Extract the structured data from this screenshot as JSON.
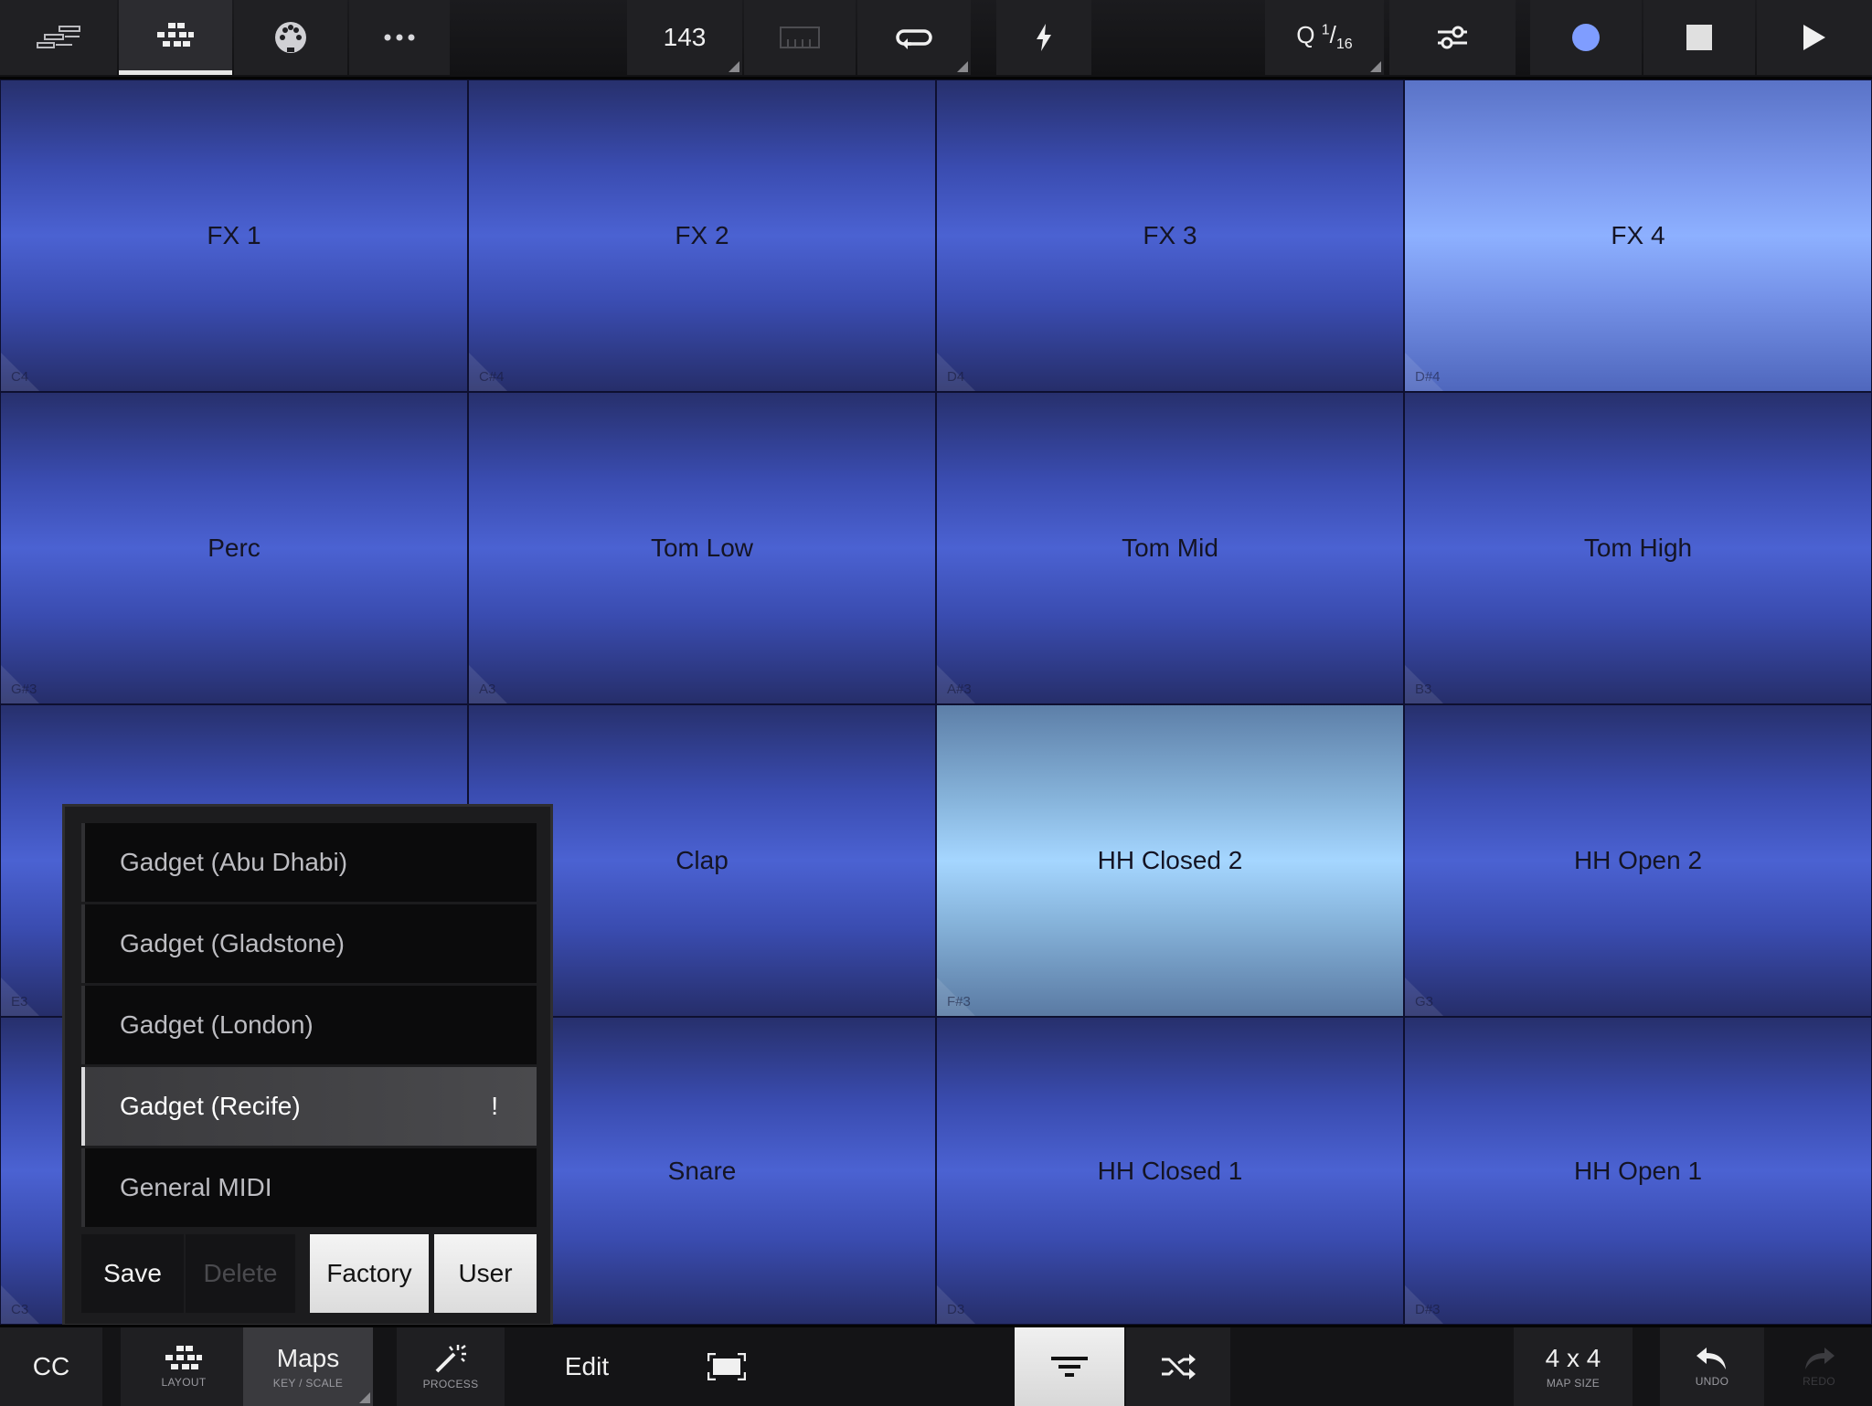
{
  "topbar": {
    "tabs": [
      "sequencer-icon",
      "pads-icon",
      "midi-port-icon",
      "more-icon"
    ],
    "tempo": "143",
    "quantize": {
      "prefix": "Q",
      "numerator": "1",
      "denominator": "16"
    },
    "icons": [
      "metronome-icon",
      "loop-icon",
      "bolt-icon",
      "mixer-icon",
      "record-icon",
      "stop-icon",
      "play-icon"
    ]
  },
  "pads": [
    {
      "name": "FX 1",
      "note": "C4"
    },
    {
      "name": "FX 2",
      "note": "C#4"
    },
    {
      "name": "FX 3",
      "note": "D4"
    },
    {
      "name": "FX 4",
      "note": "D#4"
    },
    {
      "name": "Perc",
      "note": "G#3"
    },
    {
      "name": "Tom Low",
      "note": "A3"
    },
    {
      "name": "Tom Mid",
      "note": "A#3"
    },
    {
      "name": "Tom High",
      "note": "B3"
    },
    {
      "name": "",
      "note": "E3"
    },
    {
      "name": "Clap",
      "note": ""
    },
    {
      "name": "HH Closed 2",
      "note": "F#3"
    },
    {
      "name": "HH Open 2",
      "note": "G3"
    },
    {
      "name": "",
      "note": "C3"
    },
    {
      "name": "Snare",
      "note": ""
    },
    {
      "name": "HH Closed 1",
      "note": "D3"
    },
    {
      "name": "HH Open 1",
      "note": "D#3"
    }
  ],
  "maps_popup": {
    "items": [
      {
        "label": "Gadget (Abu Dhabi)"
      },
      {
        "label": "Gadget (Gladstone)"
      },
      {
        "label": "Gadget (London)"
      },
      {
        "label": "Gadget (Recife)",
        "badge": "!"
      },
      {
        "label": "General MIDI"
      }
    ],
    "save": "Save",
    "delete": "Delete",
    "factory": "Factory",
    "user": "User"
  },
  "bottombar": {
    "cc": "CC",
    "layout": "LAYOUT",
    "maps": "Maps",
    "maps_sub": "KEY / SCALE",
    "process": "PROCESS",
    "edit": "Edit",
    "map_size": "4 x 4",
    "map_size_sub": "MAP SIZE",
    "undo": "UNDO",
    "redo": "REDO"
  }
}
